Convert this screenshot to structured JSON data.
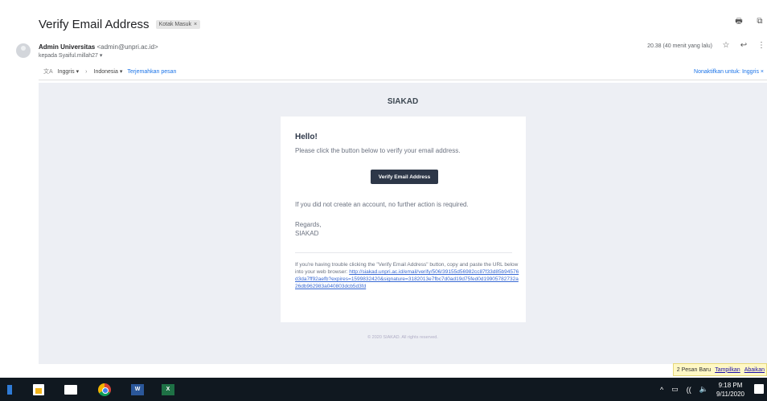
{
  "email": {
    "subject": "Verify Email Address",
    "label_chip": "Kotak Masuk",
    "label_chip_close": "×",
    "sender_name": "Admin Universitas",
    "sender_email": "<admin@unpri.ac.id>",
    "recipient": "kepada Syaiful.millah27",
    "recipient_arrow": "▾",
    "time": "20.38 (40 menit yang lalu)",
    "star_icon": "☆",
    "reply_icon": "↩",
    "more_icon": "⋮",
    "print_icon": "🖶",
    "popout_icon": "⧉"
  },
  "translate_bar": {
    "translate_icon": "文A",
    "from_lang": "Inggris",
    "dropdown_arrow": "▾",
    "arrow": "›",
    "to_lang": "Indonesia",
    "translate_link": "Terjemahkan pesan",
    "disable_link": "Nonaktifkan untuk: Inggris",
    "close_x": "×"
  },
  "message": {
    "brand": "SIAKAD",
    "greeting": "Hello!",
    "intro": "Please click the button below to verify your email address.",
    "button_label": "Verify Email Address",
    "no_action": "If you did not create an account, no further action is required.",
    "regards_line1": "Regards,",
    "regards_line2": "SIAKAD",
    "trouble_text": "If you're having trouble clicking the \"Verify Email Address\" button, copy and paste the URL below into your web browser: ",
    "verify_url": "http://siakad.unpri.ac.id/email/verify/506/39155d56982cc87f33d85b94576d3da7ff92aefb?expires=1599832420&signature=3182013e7fbc7d0ad19d75fed0d19905782732a26db962983a040803dcb5d3fd",
    "footer": "© 2020 SIAKAD. All rights reserved."
  },
  "notification": {
    "text": "2 Pesan Baru",
    "show_link": "Tampilkan",
    "ignore_link": "Abaikan"
  },
  "taskbar": {
    "time": "9:18 PM",
    "date": "9/11/2020",
    "word_label": "W",
    "excel_label": "X",
    "tray_caret": "^",
    "wifi_icon": "((",
    "volume_icon": "🔈"
  },
  "colors": {
    "email_background": "#edeff4",
    "button": "#2d3748",
    "link": "#3869d4",
    "taskbar": "#101820"
  }
}
